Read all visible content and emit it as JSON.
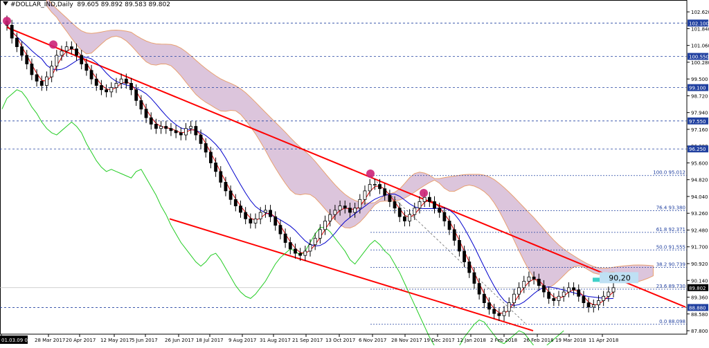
{
  "header": {
    "symbol": "#DOLLAR_IND,Daily",
    "ohlc": "89.605 89.892 89.583 89.802"
  },
  "chart_data": {
    "type": "candlestick",
    "grid": false,
    "ylim": [
      87.64,
      102.85
    ],
    "price_ticks": [
      "102.620",
      "101.840",
      "101.060",
      "100.280",
      "99.500",
      "98.720",
      "97.940",
      "97.160",
      "96.380",
      "95.600",
      "94.820",
      "94.040",
      "93.260",
      "92.480",
      "91.700",
      "90.920",
      "90.140",
      "89.360",
      "88.580",
      "87.800"
    ],
    "time_labels": [
      "01.03.09 00:00",
      "28 Mar 2017",
      "20 Apr 2017",
      "12 May 2017",
      "5 Jun 2017",
      "26 Jun 2017",
      "18 Jul 2017",
      "9 Aug 2017",
      "31 Aug 2017",
      "21 Sep 2017",
      "13 Oct 2017",
      "6 Nov 2017",
      "28 Nov 2017",
      "19 Dec 2017",
      "12 Jan 2018",
      "2 Feb 2018",
      "26 Feb 2018",
      "19 Mar 2018",
      "11 Apr 2018"
    ],
    "horizontal_levels": [
      {
        "price": 102.1,
        "label": "102.100",
        "boxed": true
      },
      {
        "price": 100.55,
        "label": "100.550",
        "boxed": true
      },
      {
        "price": 99.1,
        "label": "99.100",
        "boxed": true
      },
      {
        "price": 97.55,
        "label": "97.550",
        "boxed": true
      },
      {
        "price": 96.25,
        "label": "96.250",
        "boxed": true
      },
      {
        "price": 88.88,
        "label": "88.880",
        "boxed": true,
        "red": true
      },
      {
        "price": 89.802,
        "label": "89.802",
        "boxed": true,
        "current": true
      }
    ],
    "fibonacci": [
      {
        "label": "100.0 95.012",
        "price": 95.012
      },
      {
        "label": "76.4 93.380",
        "price": 93.38
      },
      {
        "label": "61.8 92.371",
        "price": 92.371
      },
      {
        "label": "50.0 91.555",
        "price": 91.555
      },
      {
        "label": "38.2 90.739",
        "price": 90.739
      },
      {
        "label": "23.6 89.730",
        "price": 89.73
      },
      {
        "label": "0.0 88.098",
        "price": 88.098
      }
    ],
    "annotations": [
      {
        "text": "90,20",
        "price": 90.2
      }
    ],
    "closes": [
      102.0,
      101.4,
      101.0,
      100.6,
      100.2,
      99.7,
      99.4,
      99.2,
      99.6,
      100.1,
      100.6,
      100.8,
      101.0,
      100.9,
      100.6,
      100.2,
      99.9,
      99.5,
      99.2,
      99.0,
      98.9,
      99.1,
      99.3,
      99.5,
      99.3,
      99.0,
      98.5,
      98.1,
      97.7,
      97.4,
      97.2,
      97.3,
      97.2,
      97.1,
      97.0,
      96.9,
      97.2,
      97.3,
      96.9,
      96.5,
      96.1,
      95.6,
      95.2,
      94.7,
      94.3,
      93.9,
      93.6,
      93.3,
      93.0,
      92.8,
      93.0,
      93.3,
      93.4,
      93.1,
      92.7,
      92.3,
      91.9,
      91.6,
      91.4,
      91.3,
      91.5,
      91.8,
      92.1,
      92.5,
      92.9,
      93.2,
      93.4,
      93.6,
      93.5,
      93.3,
      93.5,
      93.9,
      94.3,
      94.6,
      94.6,
      94.4,
      94.1,
      93.8,
      93.5,
      93.1,
      92.9,
      93.2,
      93.5,
      93.8,
      94.0,
      93.8,
      93.5,
      93.3,
      92.9,
      92.5,
      92.0,
      91.5,
      91.0,
      90.5,
      90.0,
      89.5,
      89.1,
      88.8,
      88.6,
      88.5,
      88.7,
      89.1,
      89.5,
      89.8,
      90.1,
      90.3,
      90.2,
      89.9,
      89.6,
      89.3,
      89.2,
      89.4,
      89.6,
      89.8,
      89.7,
      89.4,
      89.1,
      88.9,
      89.0,
      89.2,
      89.4,
      89.6,
      89.8
    ]
  }
}
